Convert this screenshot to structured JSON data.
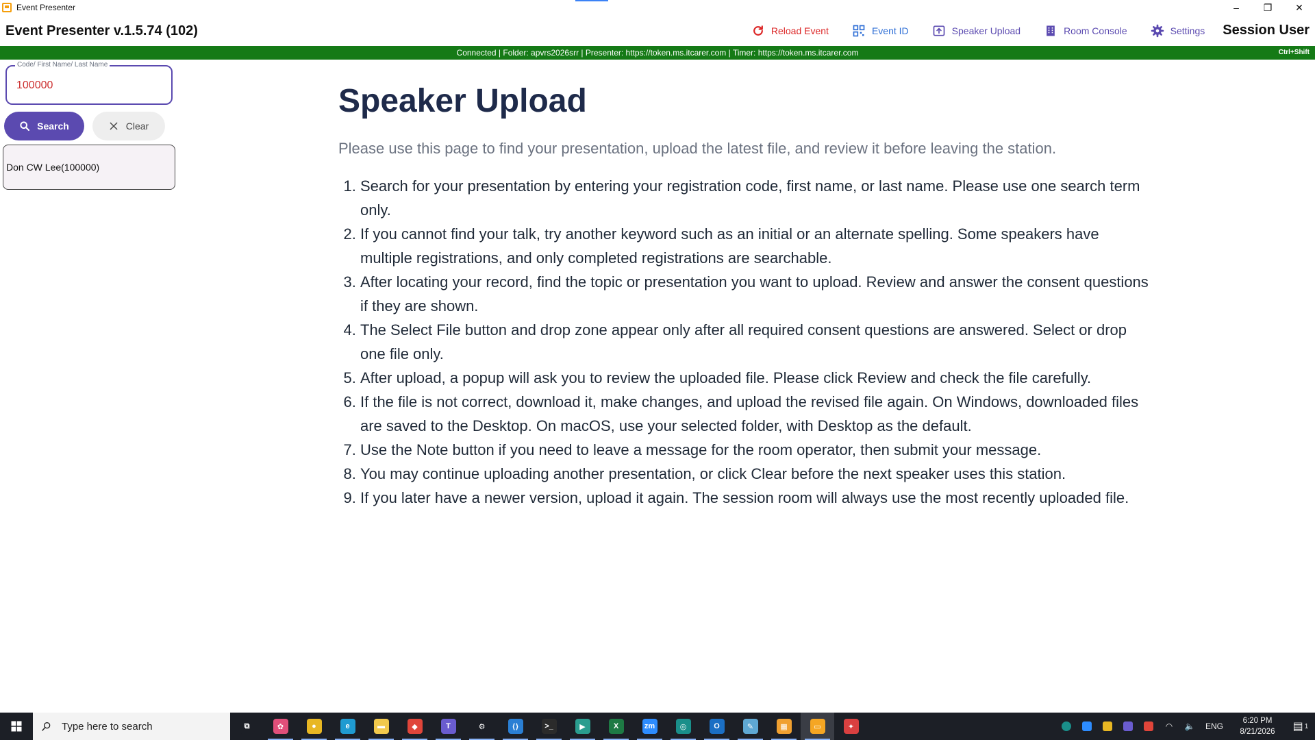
{
  "window": {
    "title": "Event Presenter",
    "minimize": "–",
    "maximize": "❐",
    "close": "✕"
  },
  "header": {
    "app_title": "Event Presenter v.1.5.74 (102)",
    "nav": {
      "reload_event": "Reload Event",
      "event_id": "Event ID",
      "speaker_upload": "Speaker Upload",
      "room_console": "Room Console",
      "settings": "Settings"
    },
    "session_user": "Session User"
  },
  "status": {
    "text": "Connected | Folder: apvrs2026srr | Presenter: https://token.ms.itcarer.com | Timer: https://token.ms.itcarer.com",
    "shortcut": "Ctrl+Shift"
  },
  "sidebar": {
    "search_label": "Code/ First Name/ Last Name",
    "search_value": "100000",
    "search_button": "Search",
    "clear_button": "Clear",
    "results": [
      "Don CW Lee(100000)"
    ]
  },
  "main": {
    "title": "Speaker Upload",
    "subtitle": "Please use this page to find your presentation, upload the latest file, and review it before leaving the station.",
    "steps": [
      "Search for your presentation by entering your registration code, first name, or last name. Please use one search term only.",
      "If you cannot find your talk, try another keyword such as an initial or an alternate spelling. Some speakers have multiple registrations, and only completed registrations are searchable.",
      "After locating your record, find the topic or presentation you want to upload. Review and answer the consent questions if they are shown.",
      "The Select File button and drop zone appear only after all required consent questions are answered. Select or drop one file only.",
      "After upload, a popup will ask you to review the uploaded file. Please click Review and check the file carefully.",
      "If the file is not correct, download it, make changes, and upload the revised file again. On Windows, downloaded files are saved to the Desktop. On macOS, use your selected folder, with Desktop as the default.",
      "Use the Note button if you need to leave a message for the room operator, then submit your message.",
      "You may continue uploading another presentation, or click Clear before the next speaker uses this station.",
      "If you later have a newer version, upload it again. The session room will always use the most recently uploaded file."
    ]
  },
  "taskbar": {
    "search_placeholder": "Type here to search",
    "apps": [
      {
        "name": "task-view-icon",
        "color": "#1c1f26",
        "glyph": "⧉"
      },
      {
        "name": "paint-icon",
        "color": "#e04f7a",
        "glyph": "✿"
      },
      {
        "name": "chrome-icon",
        "color": "#e8b723",
        "glyph": "●"
      },
      {
        "name": "edge-icon",
        "color": "#1f9bd1",
        "glyph": "e"
      },
      {
        "name": "file-explorer-icon",
        "color": "#f2c94c",
        "glyph": "▬"
      },
      {
        "name": "anydesk-icon",
        "color": "#e0453a",
        "glyph": "◆"
      },
      {
        "name": "teams-icon",
        "color": "#6a5ccf",
        "glyph": "T"
      },
      {
        "name": "settings-icon",
        "color": "#1c1f26",
        "glyph": "⚙"
      },
      {
        "name": "vscode-icon",
        "color": "#2a7fd4",
        "glyph": "⟨⟩"
      },
      {
        "name": "terminal-icon",
        "color": "#2b2b2b",
        "glyph": ">_"
      },
      {
        "name": "remote-icon",
        "color": "#2a9d8f",
        "glyph": "▶"
      },
      {
        "name": "excel-icon",
        "color": "#1e7a44",
        "glyph": "X"
      },
      {
        "name": "zoom-icon",
        "color": "#2d8cff",
        "glyph": "zm"
      },
      {
        "name": "app-circle-icon",
        "color": "#1a8f8a",
        "glyph": "◎"
      },
      {
        "name": "outlook-icon",
        "color": "#1b6fc4",
        "glyph": "O"
      },
      {
        "name": "notepad-icon",
        "color": "#5fa8d3",
        "glyph": "✎"
      },
      {
        "name": "event-presenter-alt-icon",
        "color": "#f0a030",
        "glyph": "▦"
      },
      {
        "name": "event-presenter-icon",
        "color": "#f5a623",
        "glyph": "▭"
      },
      {
        "name": "pin-icon",
        "color": "#d94040",
        "glyph": "✦"
      }
    ],
    "tray": {
      "language": "ENG",
      "time": "6:20 PM",
      "date": "8/21/2026",
      "notifications": "1"
    }
  }
}
